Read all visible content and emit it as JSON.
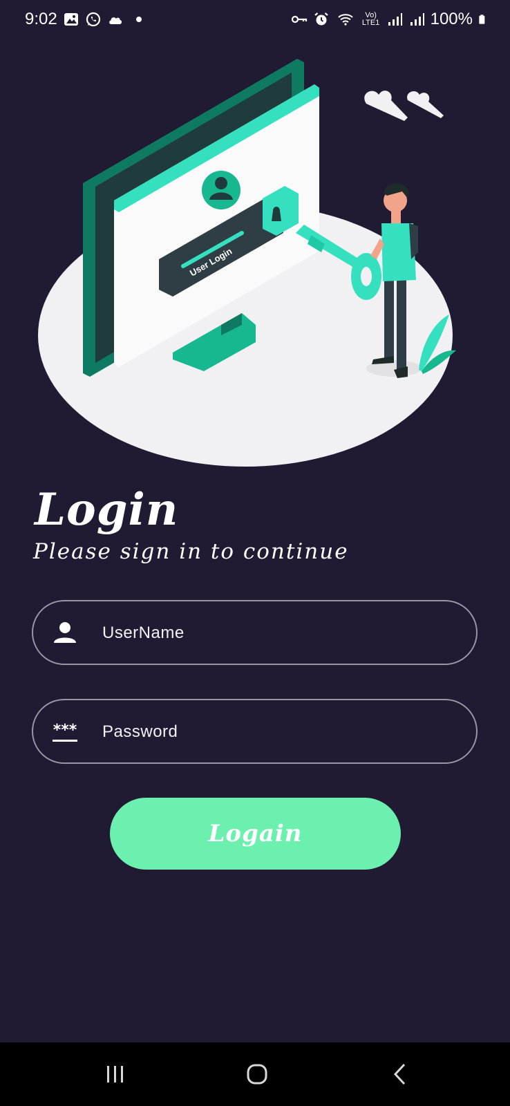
{
  "status_bar": {
    "time": "9:02",
    "network_label": "Vo) LTE1",
    "battery": "100%",
    "left_icons": [
      "gallery-icon",
      "whatsapp-icon",
      "cloud-icon",
      "dot-icon"
    ],
    "right_icons": [
      "vpn-key-icon",
      "alarm-icon",
      "wifi-icon",
      "signal-icon",
      "signal-icon",
      "battery-icon"
    ]
  },
  "illustration": {
    "screen_text": "User Login"
  },
  "header": {
    "title": "Login",
    "subtitle": "Please sign in to continue"
  },
  "form": {
    "username": {
      "placeholder": "UserName",
      "value": "",
      "icon": "person-icon"
    },
    "password": {
      "placeholder": "Password",
      "value": "",
      "icon": "password-icon"
    },
    "submit_label": "Logain"
  },
  "nav_bar": {
    "buttons": [
      "recent-apps-icon",
      "home-icon",
      "back-icon"
    ]
  },
  "colors": {
    "background": "#201b33",
    "accent": "#6cf0b0",
    "teal": "#17b890",
    "field_border": "#9a96a4",
    "nav_background": "#000000"
  }
}
